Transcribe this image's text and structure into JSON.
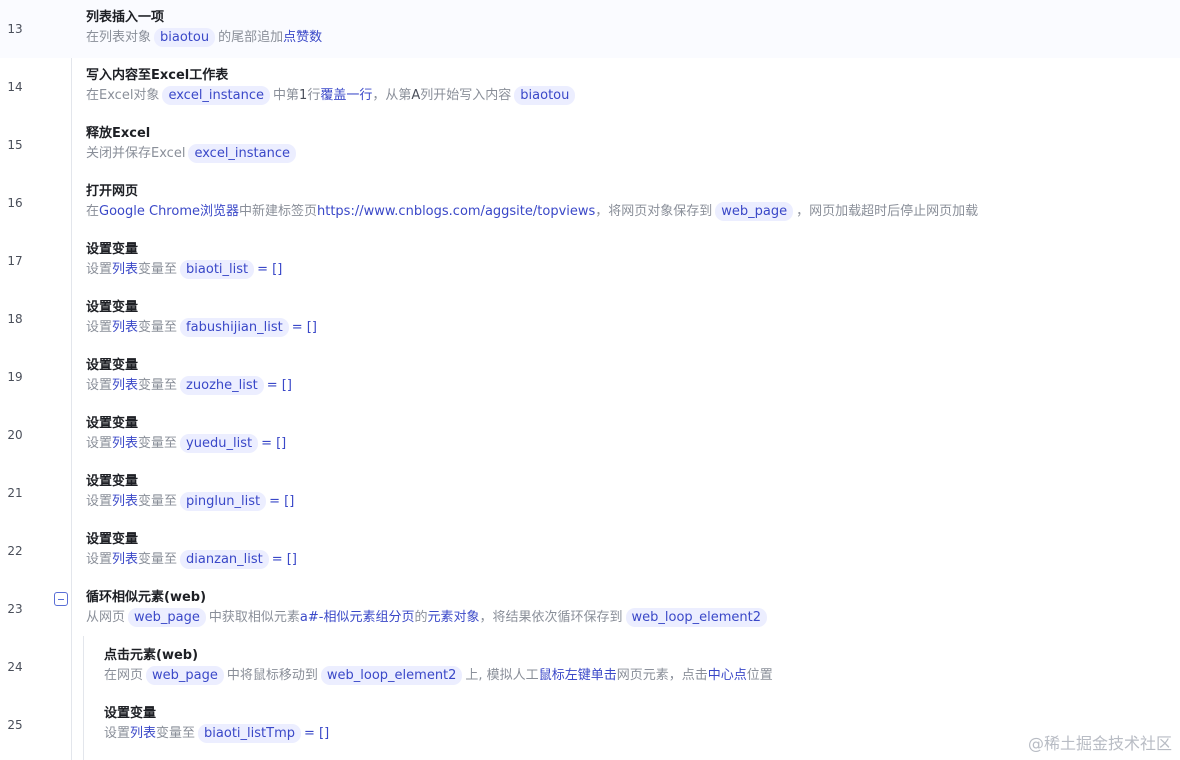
{
  "rows": [
    {
      "num": "13",
      "title": "列表插入一项",
      "parts": [
        {
          "t": "在列表对象"
        },
        {
          "t": "biaotou",
          "k": "chip"
        },
        {
          "t": "的尾部追加"
        },
        {
          "t": "点赞数",
          "k": "kw"
        }
      ]
    },
    {
      "num": "14",
      "title": "写入内容至Excel工作表",
      "parts": [
        {
          "t": "在Excel对象"
        },
        {
          "t": "excel_instance",
          "k": "chip"
        },
        {
          "t": "中第"
        },
        {
          "t": "1",
          "k": "dark"
        },
        {
          "t": "行"
        },
        {
          "t": "覆盖一行",
          "k": "kw"
        },
        {
          "t": "，从第"
        },
        {
          "t": "A",
          "k": "dark"
        },
        {
          "t": "列开始写入内容"
        },
        {
          "t": "biaotou",
          "k": "chip"
        }
      ]
    },
    {
      "num": "15",
      "title": "释放Excel",
      "parts": [
        {
          "t": "关闭并保存Excel"
        },
        {
          "t": "excel_instance",
          "k": "chip"
        }
      ]
    },
    {
      "num": "16",
      "title": "打开网页",
      "parts": [
        {
          "t": "在"
        },
        {
          "t": "Google Chrome浏览器",
          "k": "kw"
        },
        {
          "t": "中新建标签页"
        },
        {
          "t": "https://www.cnblogs.com/aggsite/topviews",
          "k": "kw"
        },
        {
          "t": "，将网页对象保存到"
        },
        {
          "t": "web_page",
          "k": "chip"
        },
        {
          "t": "，网页加载超时后停止网页加载"
        }
      ]
    },
    {
      "num": "17",
      "title": "设置变量",
      "parts": [
        {
          "t": "设置"
        },
        {
          "t": "列表",
          "k": "kw"
        },
        {
          "t": "变量至"
        },
        {
          "t": "biaoti_list",
          "k": "chip"
        },
        {
          "t": "= []",
          "k": "kw"
        }
      ]
    },
    {
      "num": "18",
      "title": "设置变量",
      "parts": [
        {
          "t": "设置"
        },
        {
          "t": "列表",
          "k": "kw"
        },
        {
          "t": "变量至"
        },
        {
          "t": "fabushijian_list",
          "k": "chip"
        },
        {
          "t": "= []",
          "k": "kw"
        }
      ]
    },
    {
      "num": "19",
      "title": "设置变量",
      "parts": [
        {
          "t": "设置"
        },
        {
          "t": "列表",
          "k": "kw"
        },
        {
          "t": "变量至"
        },
        {
          "t": "zuozhe_list",
          "k": "chip"
        },
        {
          "t": "= []",
          "k": "kw"
        }
      ]
    },
    {
      "num": "20",
      "title": "设置变量",
      "parts": [
        {
          "t": "设置"
        },
        {
          "t": "列表",
          "k": "kw"
        },
        {
          "t": "变量至"
        },
        {
          "t": "yuedu_list",
          "k": "chip"
        },
        {
          "t": "= []",
          "k": "kw"
        }
      ]
    },
    {
      "num": "21",
      "title": "设置变量",
      "parts": [
        {
          "t": "设置"
        },
        {
          "t": "列表",
          "k": "kw"
        },
        {
          "t": "变量至"
        },
        {
          "t": "pinglun_list",
          "k": "chip"
        },
        {
          "t": "= []",
          "k": "kw"
        }
      ]
    },
    {
      "num": "22",
      "title": "设置变量",
      "parts": [
        {
          "t": "设置"
        },
        {
          "t": "列表",
          "k": "kw"
        },
        {
          "t": "变量至"
        },
        {
          "t": "dianzan_list",
          "k": "chip"
        },
        {
          "t": "= []",
          "k": "kw"
        }
      ]
    },
    {
      "num": "23",
      "title": "循环相似元素(web)",
      "collapsible": true,
      "parts": [
        {
          "t": "从网页"
        },
        {
          "t": "web_page",
          "k": "chip"
        },
        {
          "t": "中获取相似元素"
        },
        {
          "t": "a#-相似元素组分页",
          "k": "kw"
        },
        {
          "t": "的"
        },
        {
          "t": "元素对象",
          "k": "kw"
        },
        {
          "t": "，将结果依次循环保存到"
        },
        {
          "t": "web_loop_element2",
          "k": "chip"
        }
      ]
    },
    {
      "num": "24",
      "title": "点击元素(web)",
      "nested": true,
      "parts": [
        {
          "t": "在网页"
        },
        {
          "t": "web_page",
          "k": "chip"
        },
        {
          "t": "中将鼠标移动到"
        },
        {
          "t": "web_loop_element2",
          "k": "chip"
        },
        {
          "t": "上, 模拟人工"
        },
        {
          "t": "鼠标左键单击",
          "k": "kw"
        },
        {
          "t": "网页元素，点击"
        },
        {
          "t": "中心点",
          "k": "kw"
        },
        {
          "t": "位置"
        }
      ]
    },
    {
      "num": "25",
      "title": "设置变量",
      "nested": true,
      "parts": [
        {
          "t": "设置"
        },
        {
          "t": "列表",
          "k": "kw"
        },
        {
          "t": "变量至"
        },
        {
          "t": "biaoti_listTmp",
          "k": "chip"
        },
        {
          "t": "= []",
          "k": "kw"
        }
      ]
    }
  ],
  "watermark": "@稀土掘金技术社区",
  "colors": {
    "chip_bg": "#eceeff",
    "chip_text": "#3a48c8",
    "keyword": "#3a48c8",
    "muted": "#8a8f99",
    "title": "#1d1f24"
  }
}
